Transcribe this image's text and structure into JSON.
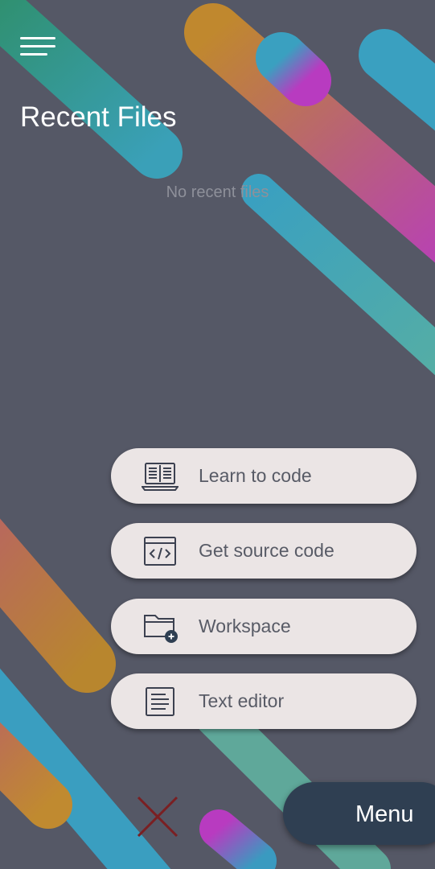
{
  "header": {
    "menu_icon": "hamburger-icon",
    "title": "Recent Files"
  },
  "recent_files": {
    "items": [],
    "empty_message": "No recent files"
  },
  "actions": [
    {
      "label": "Learn to code",
      "icon": "laptop-book-icon"
    },
    {
      "label": "Get source code",
      "icon": "code-window-icon"
    },
    {
      "label": "Workspace",
      "icon": "folder-add-icon"
    },
    {
      "label": "Text editor",
      "icon": "document-icon"
    }
  ],
  "close_button": {
    "icon": "close-icon",
    "color": "#7a1f22"
  },
  "menu_button": {
    "label": "Menu",
    "color": "#2f3f52"
  },
  "colors": {
    "background": "#555866",
    "button_background": "#ebe5e5",
    "button_text": "#585b66",
    "stripe_teal": "#3aa0b8",
    "stripe_orange": "#c0882e",
    "stripe_magenta": "#b83bc0",
    "stripe_green": "#2d8c5e"
  }
}
